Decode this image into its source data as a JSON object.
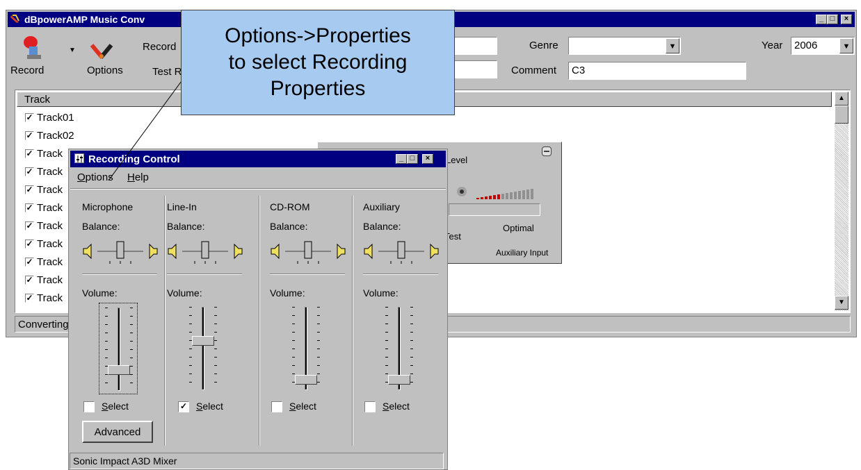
{
  "main_window": {
    "title": "dBpowerAMP Music Conv",
    "toolbar": {
      "record_label": "Record",
      "options_label": "Options",
      "record_text": "Record",
      "test_text": "Test R"
    },
    "genre_label": "Genre",
    "genre_value": "",
    "year_label": "Year",
    "year_value": "2006",
    "comment_label": "Comment",
    "comment_value": "C3",
    "list_header": "Track",
    "tracks": [
      "Track01",
      "Track02",
      "Track",
      "Track",
      "Track",
      "Track",
      "Track",
      "Track",
      "Track",
      "Track",
      "Track"
    ],
    "status": "Converting"
  },
  "callout": {
    "text_line1": "Options->Properties",
    "text_line2": "to select Recording",
    "text_line3": "Properties",
    "color": "#a6caf0"
  },
  "level_panel": {
    "level_label": "Level",
    "optimal_label": "Optimal",
    "test_label": "Test",
    "aux_label": "Auxiliary Input"
  },
  "recording_control": {
    "title": "Recording Control",
    "menu": {
      "options": "Options",
      "help": "Help"
    },
    "balance_label": "Balance:",
    "volume_label": "Volume:",
    "select_label": "Select",
    "channels": [
      {
        "name": "Microphone",
        "selected": false,
        "volume": 0.22
      },
      {
        "name": "Line-In",
        "selected": true,
        "volume": 0.6
      },
      {
        "name": "CD-ROM",
        "selected": false,
        "volume": 0.08
      },
      {
        "name": "Auxiliary",
        "selected": false,
        "volume": 0.08
      }
    ],
    "advanced_label": "Advanced",
    "status": "Sonic Impact A3D Mixer"
  },
  "colors": {
    "titlebar": "#000080",
    "face": "#c0c0c0",
    "meter": "#c00000"
  }
}
